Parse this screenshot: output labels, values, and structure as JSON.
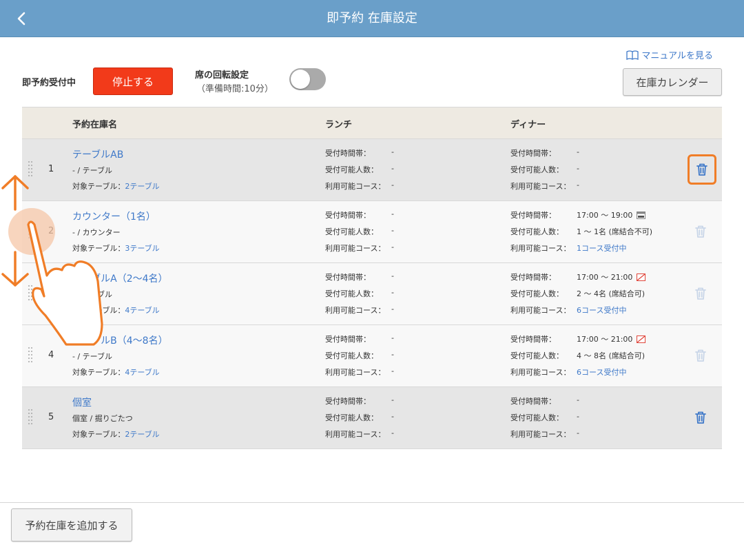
{
  "header": {
    "title": "即予約 在庫設定"
  },
  "manual_link": "マニュアルを見る",
  "controls": {
    "accepting_label": "即予約受付中",
    "stop_button": "停止する",
    "rotation_label": "席の回転設定",
    "rotation_sub": "（準備時間:10分）",
    "rotation_enabled": false,
    "calendar_button": "在庫カレンダー"
  },
  "table": {
    "headers": {
      "name": "予約在庫名",
      "lunch": "ランチ",
      "dinner": "ディナー"
    },
    "labels": {
      "time": "受付時間帯：",
      "people": "受付可能人数：",
      "course": "利用可能コース：",
      "target": "対象テーブル："
    },
    "rows": [
      {
        "num": "1",
        "name": "テーブルAB",
        "sub": "- / テーブル",
        "tables": "2テーブル",
        "lunch": {
          "time": "-",
          "people": "-",
          "course": "-"
        },
        "dinner": {
          "time": "-",
          "people": "-",
          "course": "-"
        }
      },
      {
        "num": "2",
        "name": "カウンター（1名）",
        "sub": "- / カウンター",
        "tables": "3テーブル",
        "lunch": {
          "time": "-",
          "people": "-",
          "course": "-"
        },
        "dinner": {
          "time": "17:00 〜 19:00",
          "people": "1 〜 1名 (席結合不可)",
          "course": "1コース受付中"
        }
      },
      {
        "num": "3",
        "name": "テーブルA（2〜4名）",
        "sub": "- / テーブル",
        "tables": "4テーブル",
        "lunch": {
          "time": "-",
          "people": "-",
          "course": "-"
        },
        "dinner": {
          "time": "17:00 〜 21:00",
          "people": "2 〜 4名 (席結合可)",
          "course": "6コース受付中"
        }
      },
      {
        "num": "4",
        "name": "テーブルB（4〜8名）",
        "sub": "- / テーブル",
        "tables": "4テーブル",
        "lunch": {
          "time": "-",
          "people": "-",
          "course": "-"
        },
        "dinner": {
          "time": "17:00 〜 21:00",
          "people": "4 〜 8名 (席結合可)",
          "course": "6コース受付中"
        }
      },
      {
        "num": "5",
        "name": "個室",
        "sub": "個室 / 掘りごたつ",
        "tables": "2テーブル",
        "lunch": {
          "time": "-",
          "people": "-",
          "course": "-"
        },
        "dinner": {
          "time": "-",
          "people": "-",
          "course": "-"
        }
      }
    ]
  },
  "add_button": "予約在庫を追加する",
  "colors": {
    "header": "#6a9fc9",
    "stop": "#f23a1a",
    "link": "#3f79c9",
    "highlight": "#f07d27"
  }
}
